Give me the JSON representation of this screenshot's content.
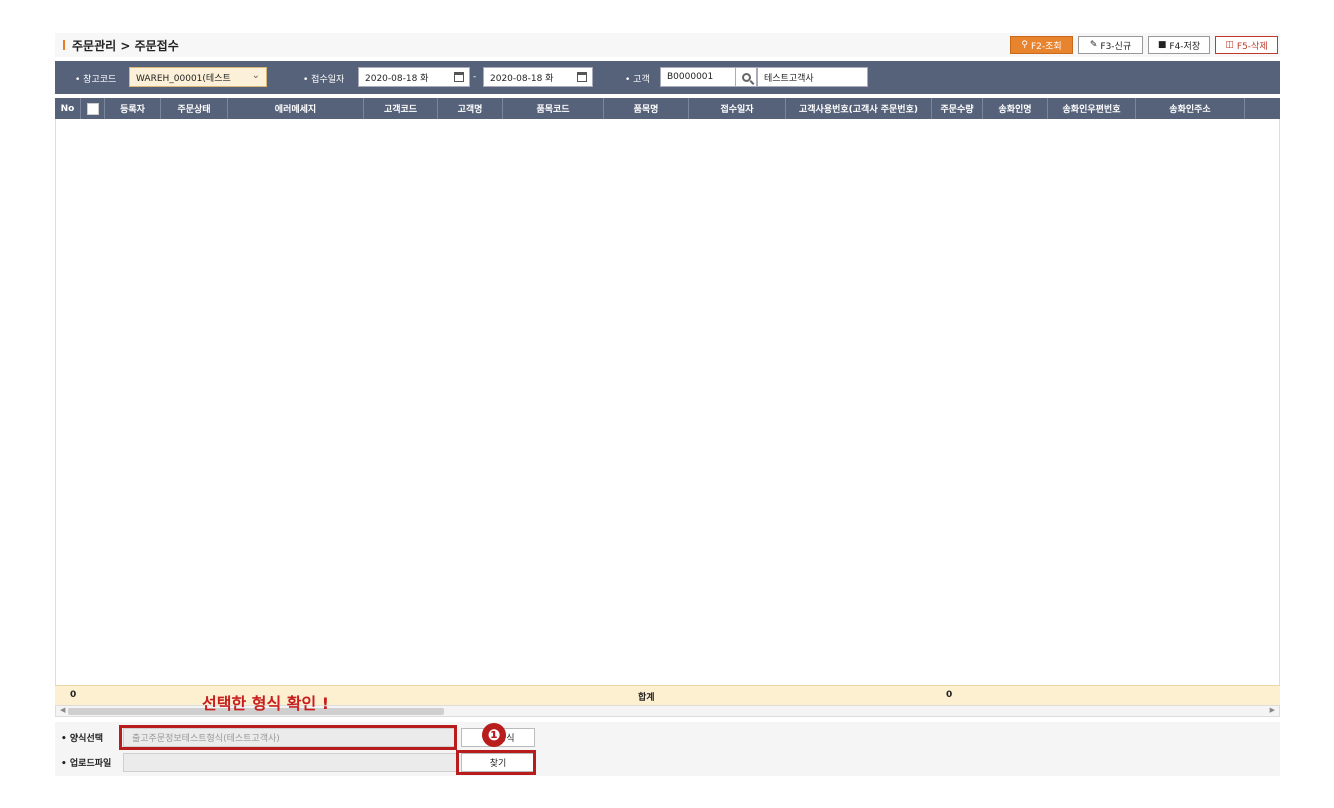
{
  "header": {
    "title": "주문관리 > 주문접수",
    "buttons": {
      "search": "F2-조회",
      "new": "F3-신규",
      "save": "F4-저장",
      "delete": "F5-삭제"
    }
  },
  "filters": {
    "warehouse_label": "창고코드",
    "warehouse_value": "WAREH_00001(테스트",
    "date_label": "접수일자",
    "date_from": "2020-08-18 화",
    "date_sep": "-",
    "date_to": "2020-08-18 화",
    "customer_label": "고객",
    "customer_code": "B0000001",
    "customer_name": "테스트고객사"
  },
  "grid": {
    "columns": [
      "No",
      "",
      "등록자",
      "주문상태",
      "에러메세지",
      "고객코드",
      "고객명",
      "품목코드",
      "품목명",
      "접수일자",
      "고객사용번호(고객사 주문번호)",
      "주문수량",
      "송화인명",
      "송화인우편번호",
      "송화인주소"
    ],
    "rows": []
  },
  "totals": {
    "count": "0",
    "label": "합계",
    "qty": "0"
  },
  "annotation": {
    "text": "선택한 형식 확인 !",
    "marker": "❶"
  },
  "bottom": {
    "form_label": "양식선택",
    "form_value": "출고주문정보테스트형식(테스트고객사)",
    "form_button": "엑셀양식",
    "upload_label": "업로드파일",
    "upload_value": "",
    "upload_button": "찾기"
  },
  "colors": {
    "header_bg": "#566279",
    "accent": "#e8832e",
    "total_bg": "#fdf0d0",
    "annotation": "#c81e1e"
  }
}
